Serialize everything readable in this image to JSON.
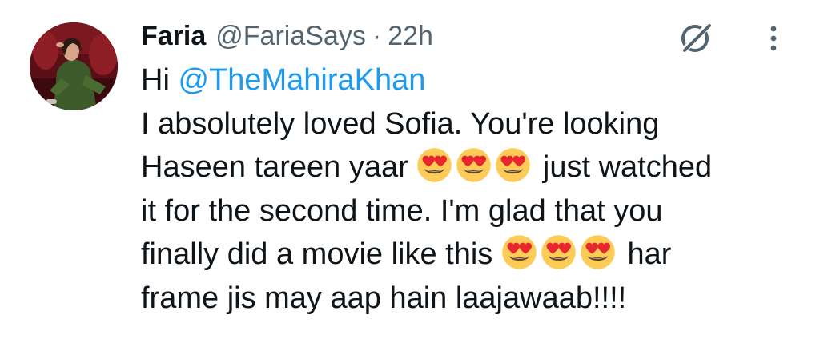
{
  "tweet": {
    "author": {
      "display_name": "Faria",
      "handle": "@FariaSays",
      "separator": "·",
      "time": "22h",
      "avatar": "profile-photo"
    },
    "icons": {
      "grok": "grok-icon",
      "more": "more-options-icon",
      "emoji": "smiling-face-with-heart-eyes-emoji"
    },
    "body": {
      "line1": {
        "greeting": "Hi",
        "mention": "@TheMahiraKhan"
      },
      "line2": "I absolutely loved Sofia. You're looking",
      "line3": {
        "before_emoji": "Haseen tareen yaar",
        "after_emoji": "just watched"
      },
      "line4": "it for the second time. I'm glad that you",
      "line5": {
        "before_emoji": "finally did a movie like this",
        "after_emoji": "har"
      },
      "line6": "frame jis may aap hain laajawaab!!!!"
    },
    "colors": {
      "text": "#0f1419",
      "secondary": "#536471",
      "link": "#1d9bf0"
    }
  }
}
